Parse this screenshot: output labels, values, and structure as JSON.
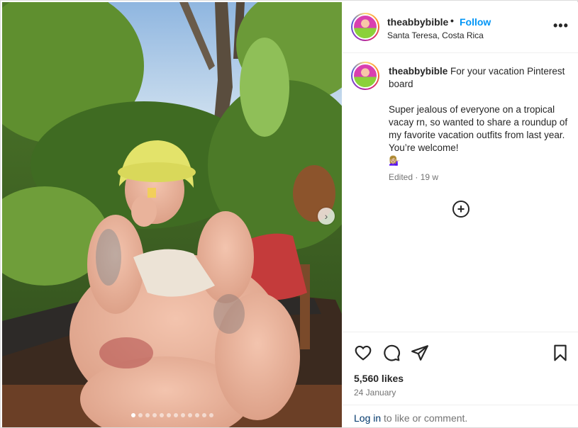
{
  "post": {
    "username": "theabbybible",
    "separator": "•",
    "follow_label": "Follow",
    "location": "Santa Teresa, Costa Rica",
    "more_icon": "more-options-icon",
    "more_glyph": "•••"
  },
  "caption": {
    "username": "theabbybible",
    "line1": "For your vacation Pinterest board",
    "line2": "Super jealous of everyone on a tropical vacay rn, so wanted to share a roundup of my favorite vacation outfits from last year. You’re welcome!",
    "emoji": "💁🏼‍♀️",
    "meta": "Edited · 19 w"
  },
  "media": {
    "next_glyph": "›",
    "slide_count": 12,
    "active_slide": 1,
    "description_icon": "photo"
  },
  "actions": {
    "like_icon": "heart-icon",
    "comment_icon": "comment-icon",
    "share_icon": "share-icon",
    "save_icon": "bookmark-icon",
    "add_icon": "plus-circle-icon",
    "plus_glyph": "+"
  },
  "stats": {
    "likes": "5,560 likes",
    "date": "24 January"
  },
  "footer": {
    "login_link": "Log in",
    "login_rest": " to like or comment."
  },
  "colors": {
    "accent": "#0095f6",
    "link_dark": "#00376b",
    "muted": "#737373",
    "text": "#262626"
  }
}
